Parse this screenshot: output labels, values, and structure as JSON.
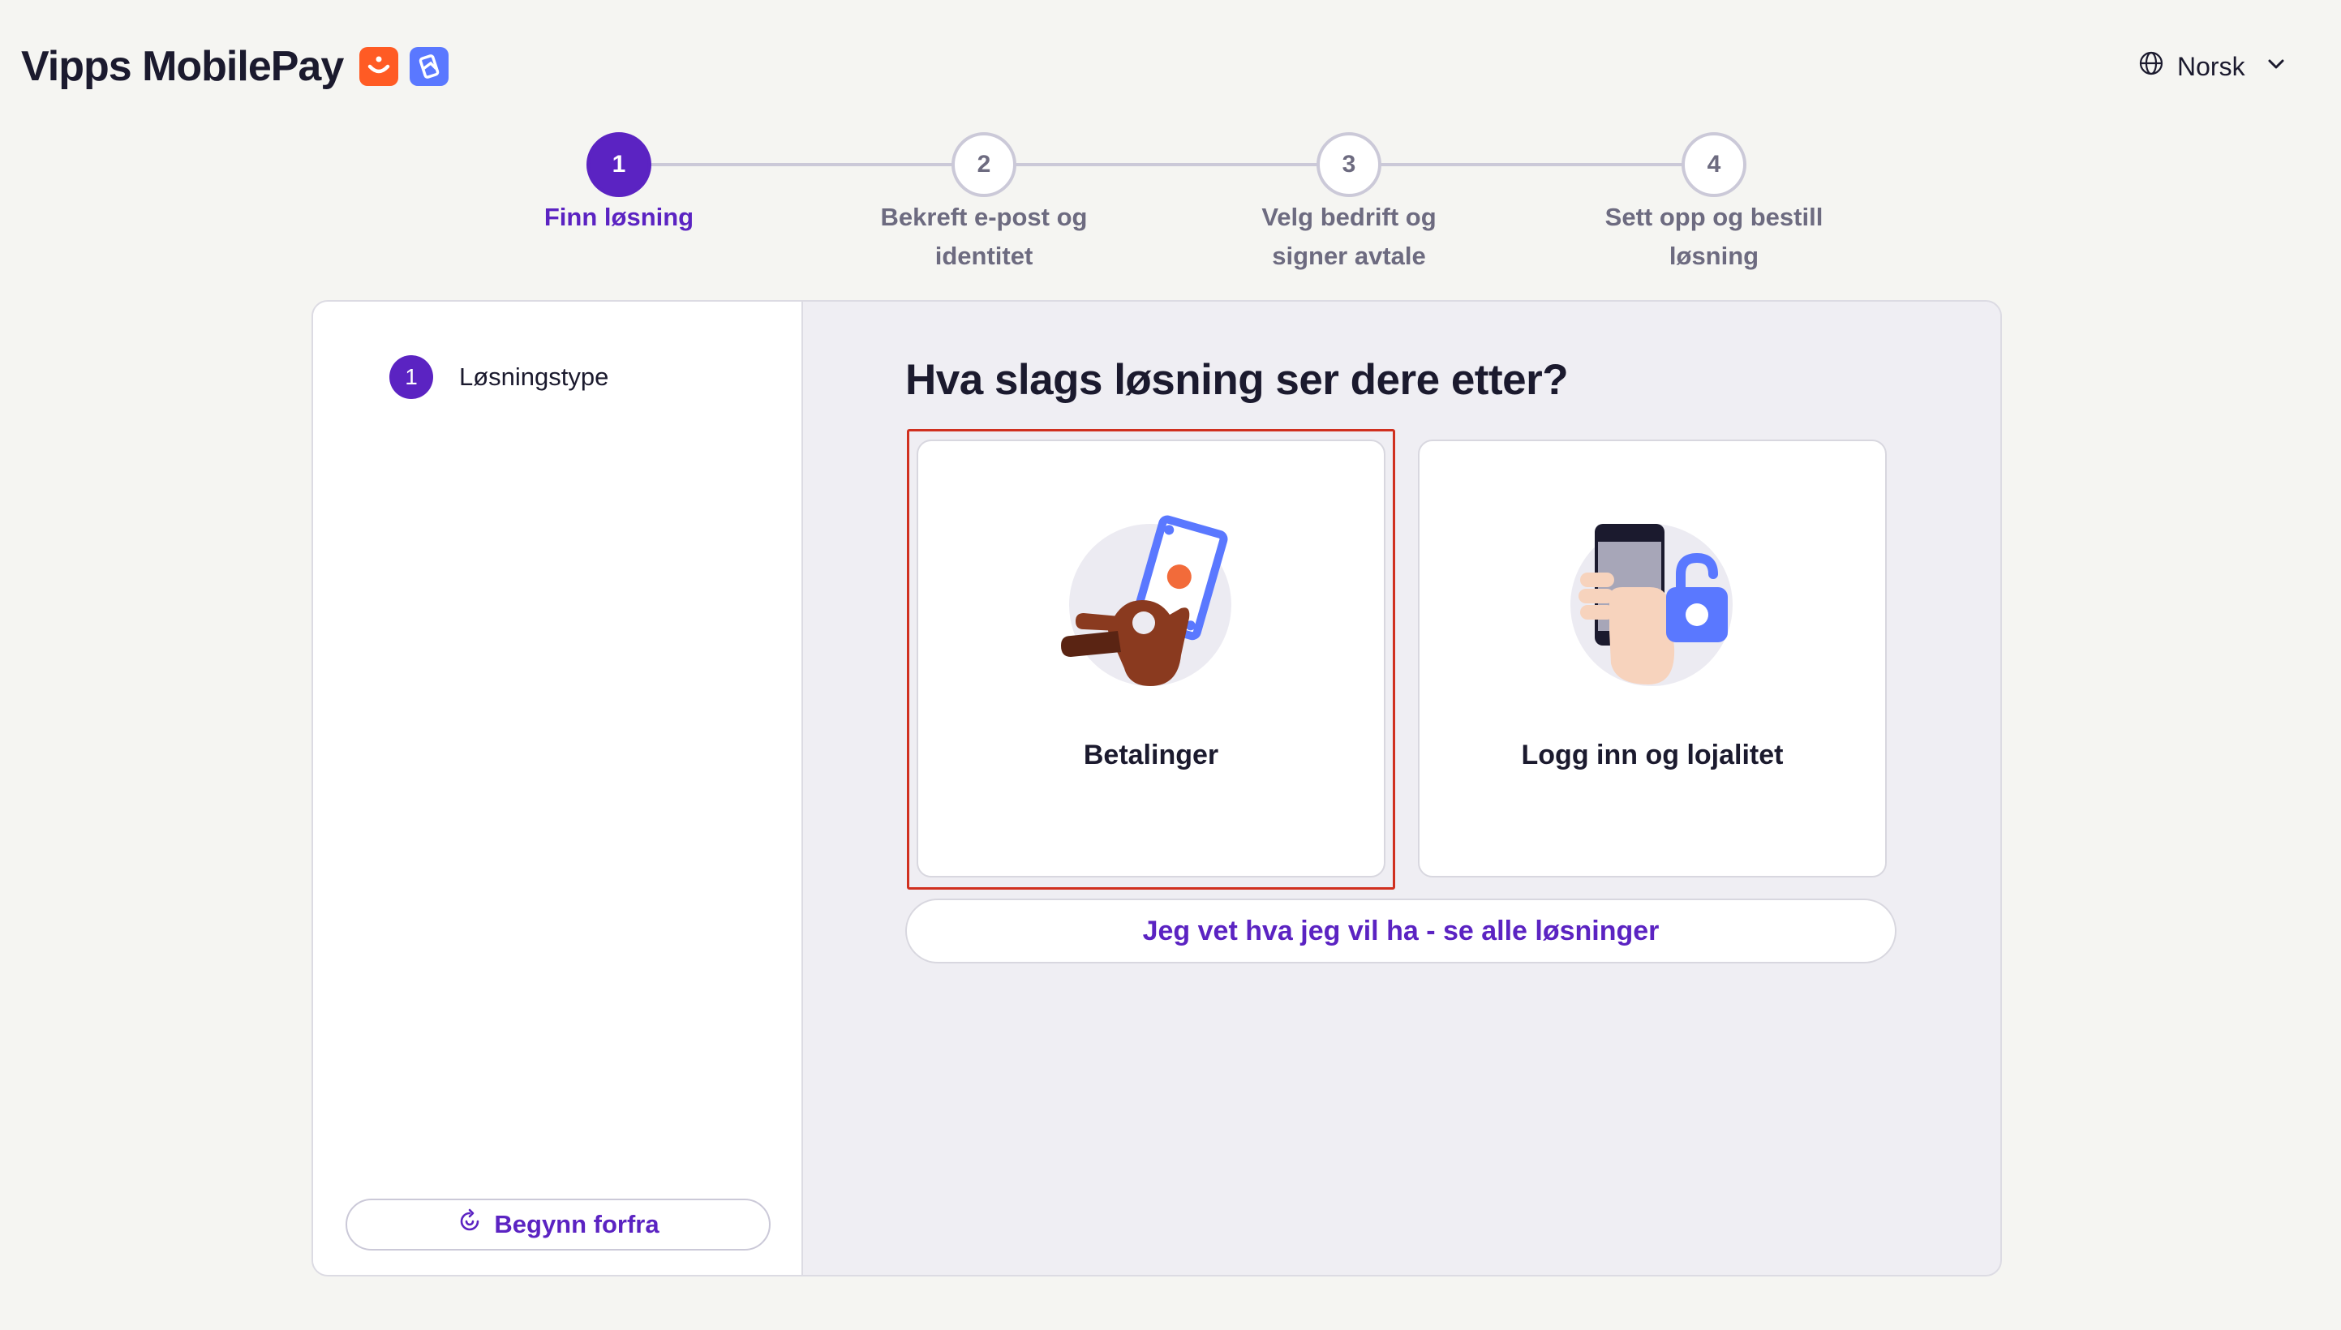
{
  "brand": {
    "name": "Vipps MobilePay",
    "colors": {
      "orange": "#ff5b24",
      "blue": "#5a78ff",
      "accent": "#5b23c2"
    }
  },
  "language": {
    "selected": "Norsk",
    "icon": "globe-icon"
  },
  "stepper": {
    "steps": [
      {
        "number": "1",
        "label_line1": "Finn løsning",
        "label_line2": "",
        "active": true
      },
      {
        "number": "2",
        "label_line1": "Bekreft e-post og",
        "label_line2": "identitet",
        "active": false
      },
      {
        "number": "3",
        "label_line1": "Velg bedrift og",
        "label_line2": "signer avtale",
        "active": false
      },
      {
        "number": "4",
        "label_line1": "Sett opp og bestill",
        "label_line2": "løsning",
        "active": false
      }
    ]
  },
  "sidebar": {
    "items": [
      {
        "number": "1",
        "label": "Løsningstype"
      }
    ],
    "restart_label": "Begynn forfra"
  },
  "main": {
    "title": "Hva slags løsning ser dere etter?",
    "options": [
      {
        "label": "Betalinger",
        "icon": "hand-with-banknote-icon",
        "selected": true
      },
      {
        "label": "Logg inn og lojalitet",
        "icon": "phone-with-padlock-icon",
        "selected": false
      }
    ],
    "all_solutions_label": "Jeg vet hva jeg vil ha - se alle løsninger"
  }
}
